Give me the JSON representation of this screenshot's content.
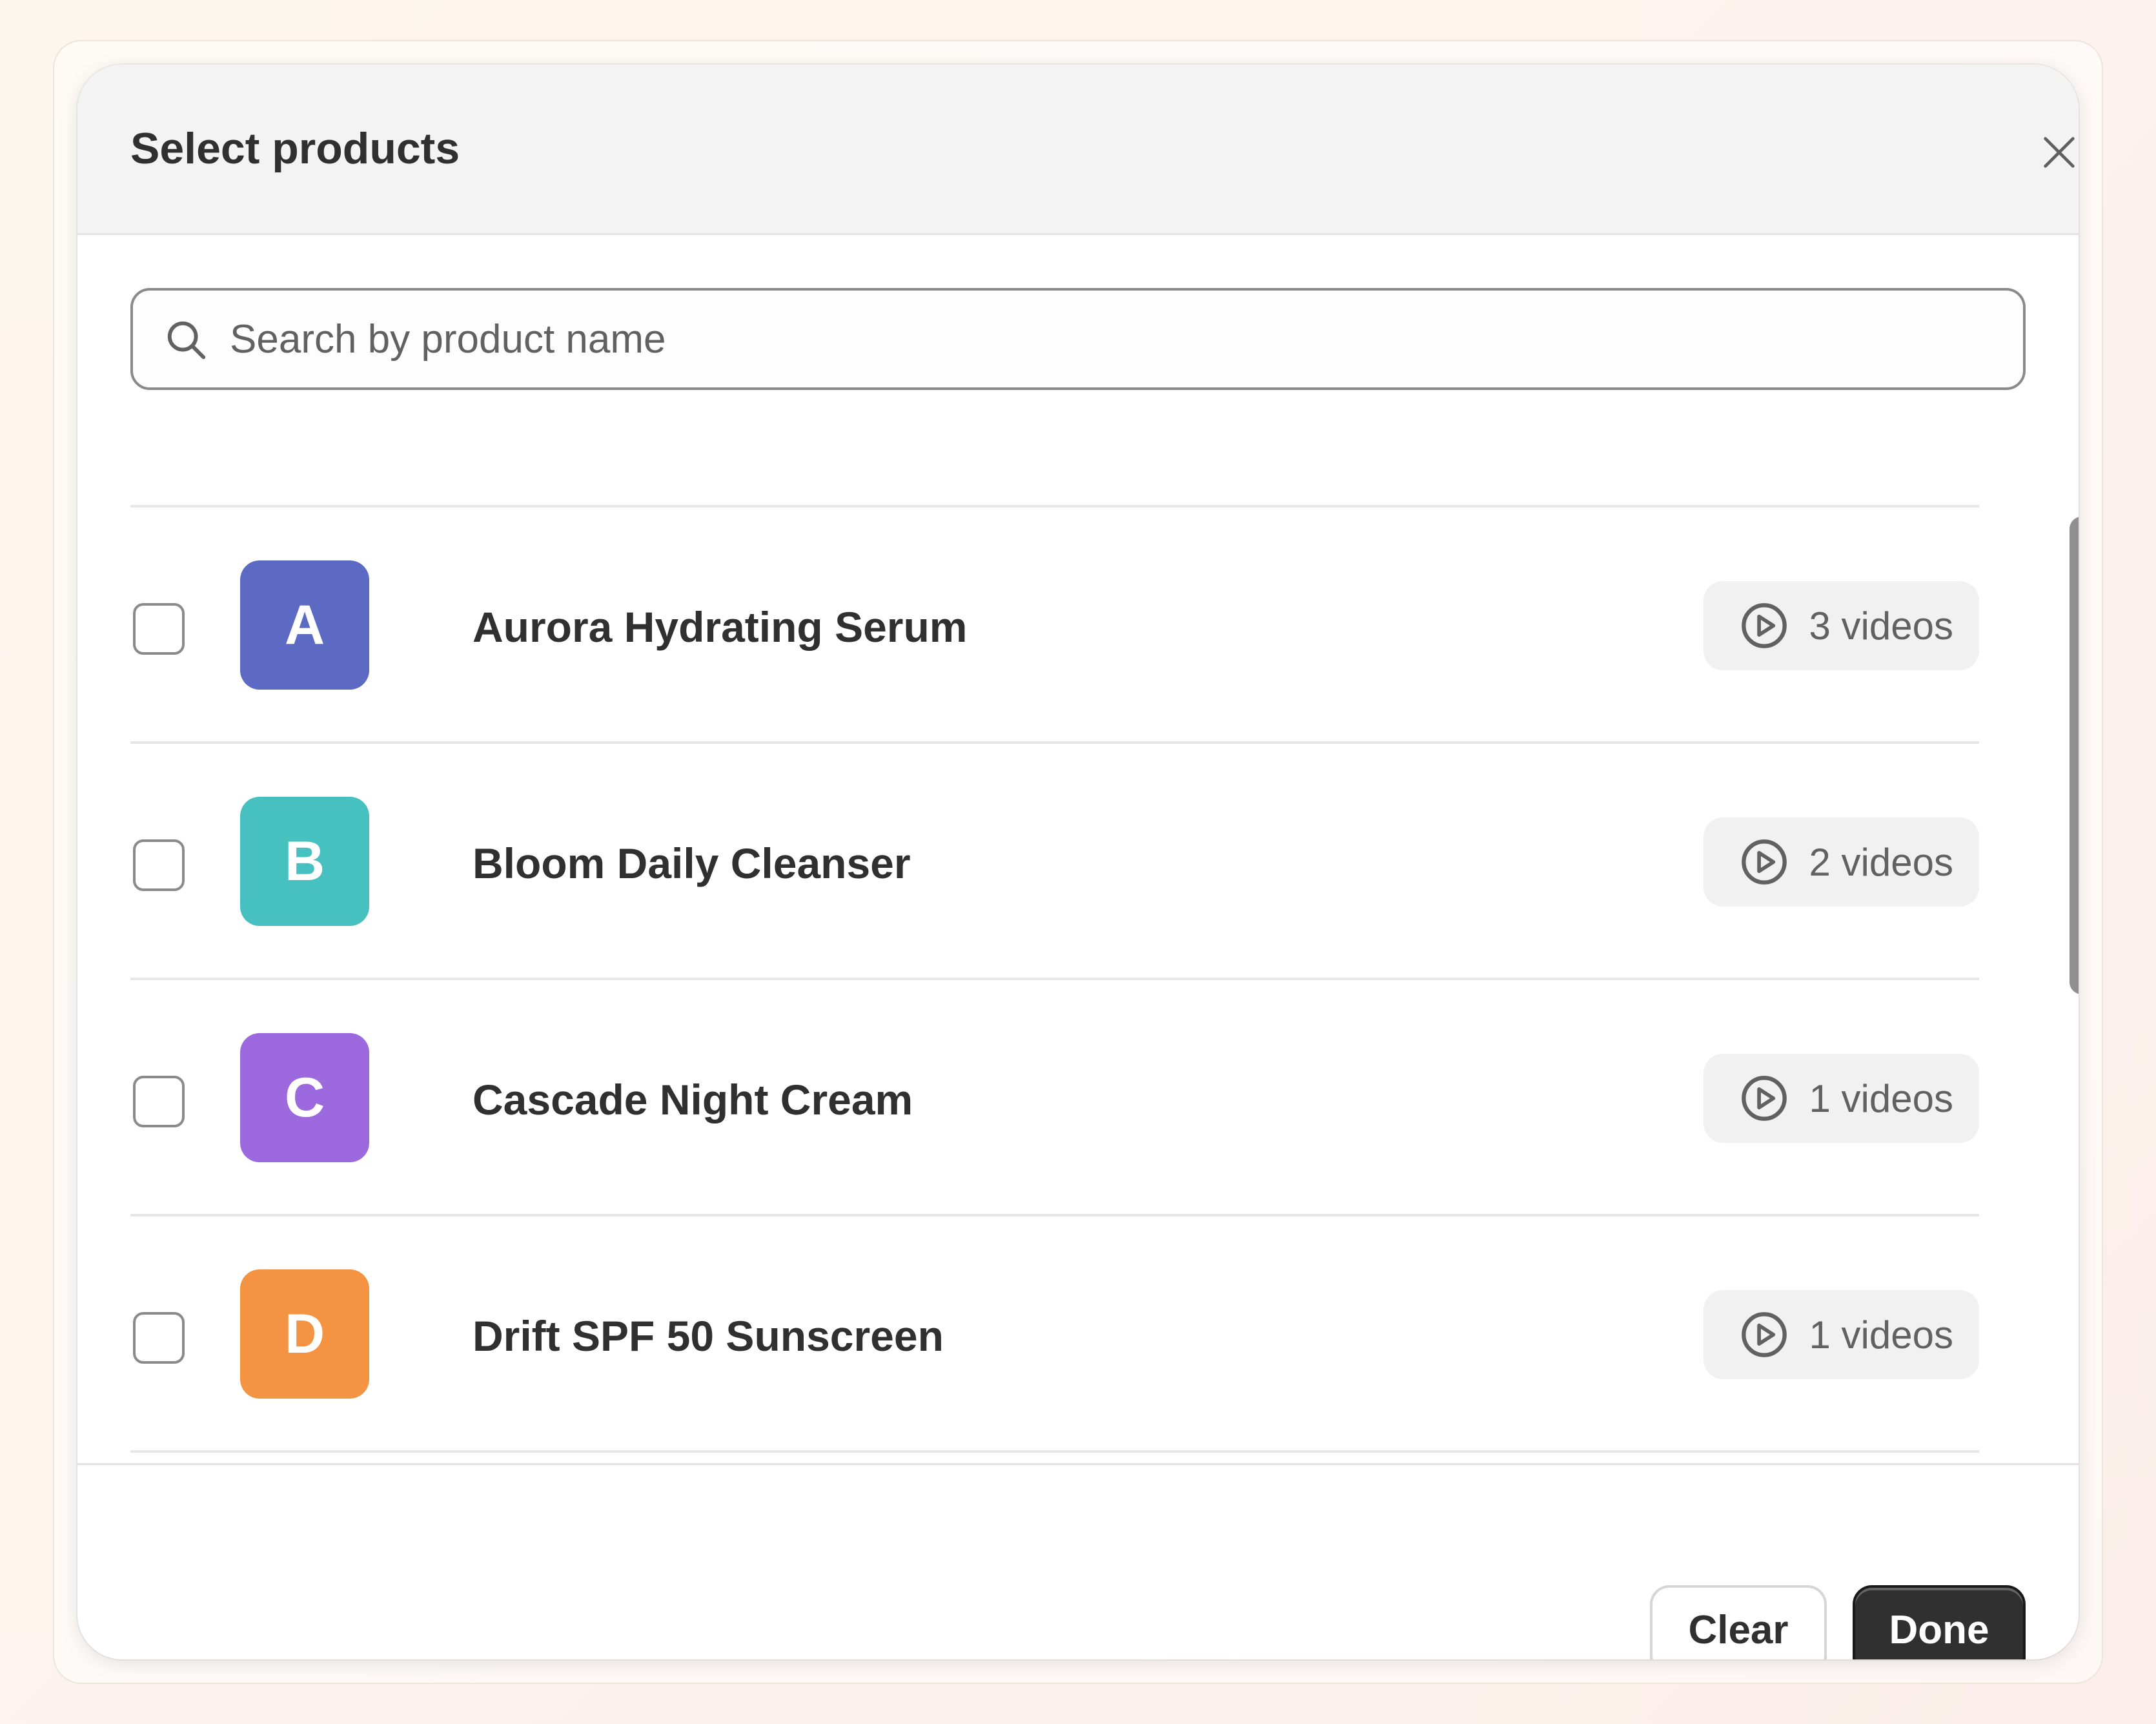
{
  "dialog": {
    "title": "Select products",
    "close_icon": "close-icon"
  },
  "search": {
    "placeholder": "Search by product name",
    "value": "",
    "icon": "search-icon"
  },
  "products": [
    {
      "initial": "A",
      "name": "Aurora Hydrating Serum",
      "videos": "3 videos",
      "color": "#5c6ac4",
      "checked": false
    },
    {
      "initial": "B",
      "name": "Bloom Daily Cleanser",
      "videos": "2 videos",
      "color": "#47c1bf",
      "checked": false
    },
    {
      "initial": "C",
      "name": "Cascade Night Cream",
      "videos": "1 videos",
      "color": "#9c6ade",
      "checked": false
    },
    {
      "initial": "D",
      "name": "Drift SPF 50 Sunscreen",
      "videos": "1 videos",
      "color": "#f49342",
      "checked": false
    }
  ],
  "footer": {
    "clear_label": "Clear",
    "done_label": "Done"
  },
  "colors": {
    "primary_button": "#303030",
    "header_background": "#f3f3f3"
  }
}
